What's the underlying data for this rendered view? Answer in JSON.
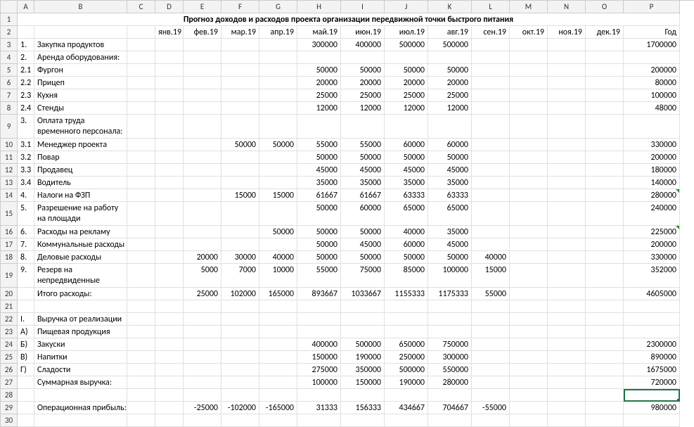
{
  "colHeaders": [
    "A",
    "B",
    "C",
    "D",
    "E",
    "F",
    "G",
    "H",
    "I",
    "J",
    "K",
    "L",
    "M",
    "N",
    "O",
    "P"
  ],
  "rowCount": 30,
  "title": "Прогноз доходов и расходов проекта организации передвижной точки быстрого питания",
  "months": [
    "янв.19",
    "фев.19",
    "мар.19",
    "апр.19",
    "май.19",
    "июн.19",
    "июл.19",
    "авг.19",
    "сен.19",
    "окт.19",
    "ноя.19",
    "дек.19"
  ],
  "yearLabel": "Год",
  "rows": [
    {
      "r": 3,
      "tall": false,
      "a": "1.",
      "b": "Закупка продуктов",
      "vals": [
        "",
        "",
        "",
        "",
        "300000",
        "400000",
        "500000",
        "500000",
        "",
        "",
        "",
        ""
      ],
      "year": "1700000"
    },
    {
      "r": 4,
      "tall": false,
      "a": "2.",
      "b": "Аренда оборудования:",
      "vals": [
        "",
        "",
        "",
        "",
        "",
        "",
        "",
        "",
        "",
        "",
        "",
        ""
      ],
      "year": ""
    },
    {
      "r": 5,
      "tall": false,
      "a": "2.1",
      "b": "Фургон",
      "vals": [
        "",
        "",
        "",
        "",
        "50000",
        "50000",
        "50000",
        "50000",
        "",
        "",
        "",
        ""
      ],
      "year": "200000"
    },
    {
      "r": 6,
      "tall": false,
      "a": "2.2",
      "b": "Прицеп",
      "vals": [
        "",
        "",
        "",
        "",
        "20000",
        "20000",
        "20000",
        "20000",
        "",
        "",
        "",
        ""
      ],
      "year": "80000"
    },
    {
      "r": 7,
      "tall": false,
      "a": "2.3",
      "b": "Кухня",
      "vals": [
        "",
        "",
        "",
        "",
        "25000",
        "25000",
        "25000",
        "25000",
        "",
        "",
        "",
        ""
      ],
      "year": "100000"
    },
    {
      "r": 8,
      "tall": false,
      "a": "2.4",
      "b": "Стенды",
      "vals": [
        "",
        "",
        "",
        "",
        "12000",
        "12000",
        "12000",
        "12000",
        "",
        "",
        "",
        ""
      ],
      "year": "48000"
    },
    {
      "r": 9,
      "tall": true,
      "a": "3.",
      "b": "Оплата труда временного персонала:",
      "vals": [
        "",
        "",
        "",
        "",
        "",
        "",
        "",
        "",
        "",
        "",
        "",
        ""
      ],
      "year": ""
    },
    {
      "r": 10,
      "tall": false,
      "a": "3.1",
      "b": "Менеджер проекта",
      "vals": [
        "",
        "",
        "50000",
        "50000",
        "55000",
        "55000",
        "60000",
        "60000",
        "",
        "",
        "",
        ""
      ],
      "year": "330000"
    },
    {
      "r": 11,
      "tall": false,
      "a": "3.2",
      "b": "Повар",
      "vals": [
        "",
        "",
        "",
        "",
        "50000",
        "50000",
        "50000",
        "50000",
        "",
        "",
        "",
        ""
      ],
      "year": "200000"
    },
    {
      "r": 12,
      "tall": false,
      "a": "3.3",
      "b": "Продавец",
      "vals": [
        "",
        "",
        "",
        "",
        "45000",
        "45000",
        "45000",
        "45000",
        "",
        "",
        "",
        ""
      ],
      "year": "180000"
    },
    {
      "r": 13,
      "tall": false,
      "a": "3.4",
      "b": "Водитель",
      "vals": [
        "",
        "",
        "",
        "",
        "35000",
        "35000",
        "35000",
        "35000",
        "",
        "",
        "",
        ""
      ],
      "year": "140000"
    },
    {
      "r": 14,
      "tall": false,
      "a": "4.",
      "b": "Налоги на ФЗП",
      "vals": [
        "",
        "",
        "15000",
        "15000",
        "61667",
        "61667",
        "63333",
        "63333",
        "",
        "",
        "",
        ""
      ],
      "year": "280000",
      "triYear": true
    },
    {
      "r": 15,
      "tall": true,
      "a": "5.",
      "b": "Разрешение на работу на площади",
      "vals": [
        "",
        "",
        "",
        "",
        "50000",
        "60000",
        "65000",
        "65000",
        "",
        "",
        "",
        ""
      ],
      "year": "240000"
    },
    {
      "r": 16,
      "tall": false,
      "a": "6.",
      "b": "Расходы на рекламу",
      "vals": [
        "",
        "",
        "",
        "50000",
        "50000",
        "50000",
        "40000",
        "35000",
        "",
        "",
        "",
        ""
      ],
      "year": "225000",
      "triYear": true
    },
    {
      "r": 17,
      "tall": false,
      "a": "7.",
      "b": "Коммунальные расходы",
      "vals": [
        "",
        "",
        "",
        "",
        "50000",
        "45000",
        "60000",
        "45000",
        "",
        "",
        "",
        ""
      ],
      "year": "200000"
    },
    {
      "r": 18,
      "tall": false,
      "a": "8.",
      "b": "Деловые расходы",
      "vals": [
        "",
        "20000",
        "30000",
        "40000",
        "50000",
        "50000",
        "50000",
        "50000",
        "40000",
        "",
        "",
        ""
      ],
      "year": "330000"
    },
    {
      "r": 19,
      "tall": true,
      "a": "9.",
      "b": "Резерв на непредвиденные нужды",
      "vals": [
        "",
        "5000",
        "7000",
        "10000",
        "55000",
        "75000",
        "85000",
        "100000",
        "15000",
        "",
        "",
        ""
      ],
      "year": "352000"
    },
    {
      "r": 20,
      "tall": false,
      "a": "",
      "b": "Итого расходы:",
      "vals": [
        "",
        "25000",
        "102000",
        "165000",
        "893667",
        "1033667",
        "1155333",
        "1175333",
        "55000",
        "",
        "",
        ""
      ],
      "year": "4605000"
    },
    {
      "r": 21,
      "tall": false,
      "a": "",
      "b": "",
      "vals": [
        "",
        "",
        "",
        "",
        "",
        "",
        "",
        "",
        "",
        "",
        "",
        ""
      ],
      "year": ""
    },
    {
      "r": 22,
      "tall": false,
      "a": "I.",
      "b": "Выручка от реализации",
      "vals": [
        "",
        "",
        "",
        "",
        "",
        "",
        "",
        "",
        "",
        "",
        "",
        ""
      ],
      "year": ""
    },
    {
      "r": 23,
      "tall": false,
      "a": "А)",
      "b": "Пищевая продукция",
      "vals": [
        "",
        "",
        "",
        "",
        "",
        "",
        "",
        "",
        "",
        "",
        "",
        ""
      ],
      "year": ""
    },
    {
      "r": 24,
      "tall": false,
      "a": "Б)",
      "b": "Закуски",
      "vals": [
        "",
        "",
        "",
        "",
        "400000",
        "500000",
        "650000",
        "750000",
        "",
        "",
        "",
        ""
      ],
      "year": "2300000"
    },
    {
      "r": 25,
      "tall": false,
      "a": "В)",
      "b": "Напитки",
      "vals": [
        "",
        "",
        "",
        "",
        "150000",
        "190000",
        "250000",
        "300000",
        "",
        "",
        "",
        ""
      ],
      "year": "890000"
    },
    {
      "r": 26,
      "tall": false,
      "a": "Г)",
      "b": "Сладости",
      "vals": [
        "",
        "",
        "",
        "",
        "275000",
        "350000",
        "500000",
        "550000",
        "",
        "",
        "",
        ""
      ],
      "year": "1675000"
    },
    {
      "r": 27,
      "tall": false,
      "a": "",
      "b": "Суммарная выручка:",
      "vals": [
        "",
        "",
        "",
        "",
        "100000",
        "150000",
        "190000",
        "280000",
        "",
        "",
        "",
        ""
      ],
      "year": "720000"
    },
    {
      "r": 28,
      "tall": false,
      "a": "",
      "b": "",
      "vals": [
        "",
        "",
        "",
        "",
        "",
        "",
        "",
        "",
        "",
        "",
        "",
        ""
      ],
      "year": "",
      "selected": true
    },
    {
      "r": 29,
      "tall": false,
      "a": "",
      "b": "Операционная прибыль:",
      "vals": [
        "",
        "-25000",
        "-102000",
        "-165000",
        "31333",
        "156333",
        "434667",
        "704667",
        "-55000",
        "",
        "",
        ""
      ],
      "year": "980000"
    },
    {
      "r": 30,
      "tall": false,
      "a": "",
      "b": "",
      "vals": [
        "",
        "",
        "",
        "",
        "",
        "",
        "",
        "",
        "",
        "",
        "",
        ""
      ],
      "year": ""
    }
  ]
}
